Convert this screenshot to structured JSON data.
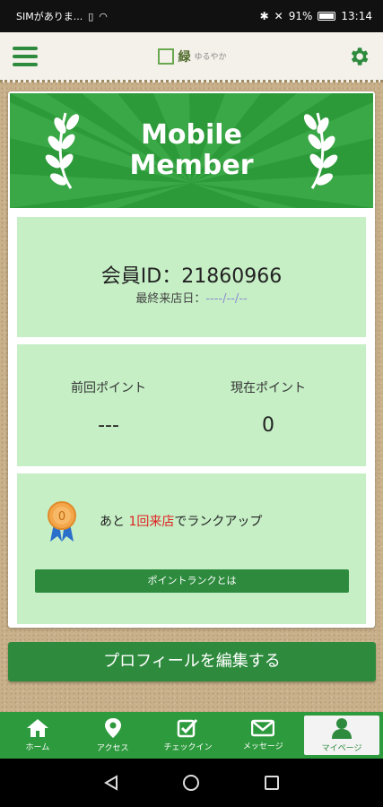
{
  "status_bar": {
    "carrier": "SIMがありま...",
    "battery_percent": "91%",
    "time": "13:14"
  },
  "header": {
    "logo_text": "緑",
    "logo_sub": "ゆるやか"
  },
  "banner": {
    "line1": "Mobile",
    "line2": "Member"
  },
  "member": {
    "id_label": "会員ID：21860966",
    "last_visit_label": "最終来店日：",
    "last_visit_value": "----/--/--"
  },
  "points": {
    "previous_label": "前回ポイント",
    "previous_value": "---",
    "current_label": "現在ポイント",
    "current_value": "0"
  },
  "rank": {
    "medal_value": "0",
    "msg_prefix": "あと",
    "msg_highlight": "1回来店",
    "msg_suffix": "でランクアップ",
    "button_label": "ポイントランクとは"
  },
  "edit_profile_label": "プロフィールを編集する",
  "bottom_nav": [
    {
      "label": "ホーム",
      "icon": "home-icon"
    },
    {
      "label": "アクセス",
      "icon": "map-pin-icon"
    },
    {
      "label": "チェックイン",
      "icon": "checkbox-icon"
    },
    {
      "label": "メッセージ",
      "icon": "envelope-icon"
    },
    {
      "label": "マイページ",
      "icon": "person-icon"
    }
  ],
  "colors": {
    "primary_green": "#2e8b3e",
    "panel_green": "#c6efc6",
    "highlight_red": "#e02020"
  }
}
